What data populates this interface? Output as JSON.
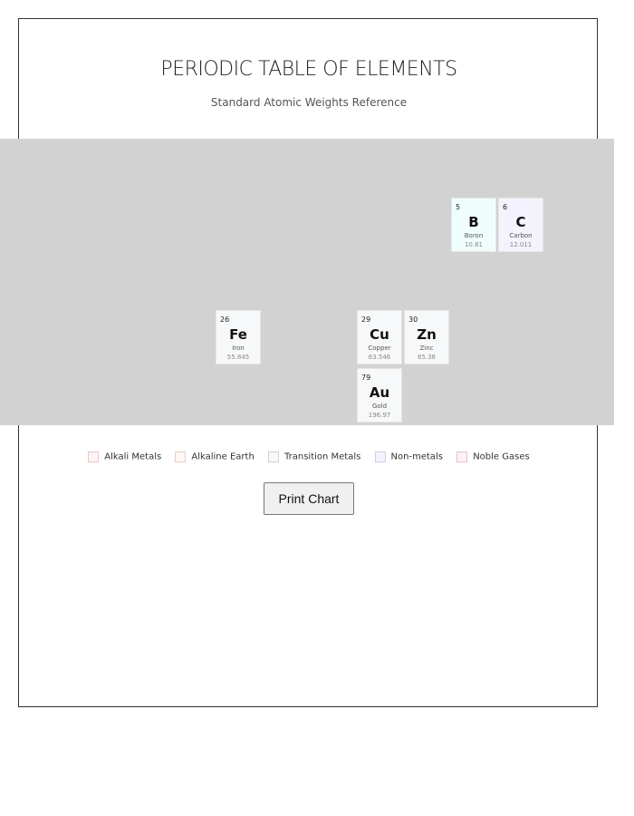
{
  "header": {
    "title": "PERIODIC TABLE OF ELEMENTS",
    "subtitle": "Standard Atomic Weights Reference"
  },
  "elements": [
    {
      "number": "5",
      "symbol": "B",
      "name": "Boron",
      "weight": "10.81",
      "color": "#f0fdfd"
    },
    {
      "number": "6",
      "symbol": "C",
      "name": "Carbon",
      "weight": "12.011",
      "color": "#f4f2fc"
    },
    {
      "number": "26",
      "symbol": "Fe",
      "name": "Iron",
      "weight": "55.845",
      "color": "#f7f8f9"
    },
    {
      "number": "29",
      "symbol": "Cu",
      "name": "Copper",
      "weight": "63.546",
      "color": "#f7f8f9"
    },
    {
      "number": "30",
      "symbol": "Zn",
      "name": "Zinc",
      "weight": "65.38",
      "color": "#f7f8f9"
    },
    {
      "number": "79",
      "symbol": "Au",
      "name": "Gold",
      "weight": "196.97",
      "color": "#f7f8f9"
    }
  ],
  "legend": [
    {
      "label": "Alkali Metals",
      "color": "#fff4f4",
      "border": "#e8c4c4"
    },
    {
      "label": "Alkaline Earth",
      "color": "#fff8f4",
      "border": "#e8cfc0"
    },
    {
      "label": "Transition Metals",
      "color": "#f7f8f9",
      "border": "#c8d0d8"
    },
    {
      "label": "Non-metals",
      "color": "#f4f2fc",
      "border": "#d0cce8"
    },
    {
      "label": "Noble Gases",
      "color": "#fff2f4",
      "border": "#e8c0c8"
    }
  ],
  "actions": {
    "print_label": "Print Chart"
  }
}
